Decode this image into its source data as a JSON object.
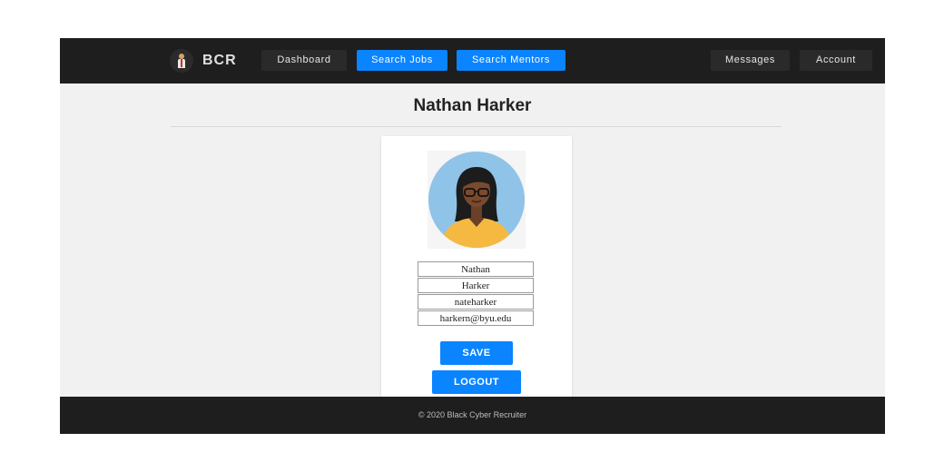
{
  "brand": {
    "name": "BCR",
    "logo_icon": "person-tie-icon"
  },
  "nav": {
    "dashboard": "Dashboard",
    "search_jobs": "Search Jobs",
    "search_mentors": "Search Mentors",
    "messages": "Messages",
    "account": "Account"
  },
  "profile": {
    "title": "Nathan Harker",
    "avatar_icon": "user-avatar-icon",
    "fields": {
      "first_name": "Nathan",
      "last_name": "Harker",
      "username": "nateharker",
      "email": "harkern@byu.edu"
    },
    "save_label": "SAVE",
    "logout_label": "LOGOUT"
  },
  "footer": {
    "copyright": "© 2020 Black Cyber Recruiter"
  },
  "colors": {
    "nav_bg": "#1e1e1e",
    "accent": "#0a84ff",
    "page_bg": "#f1f1f1"
  }
}
